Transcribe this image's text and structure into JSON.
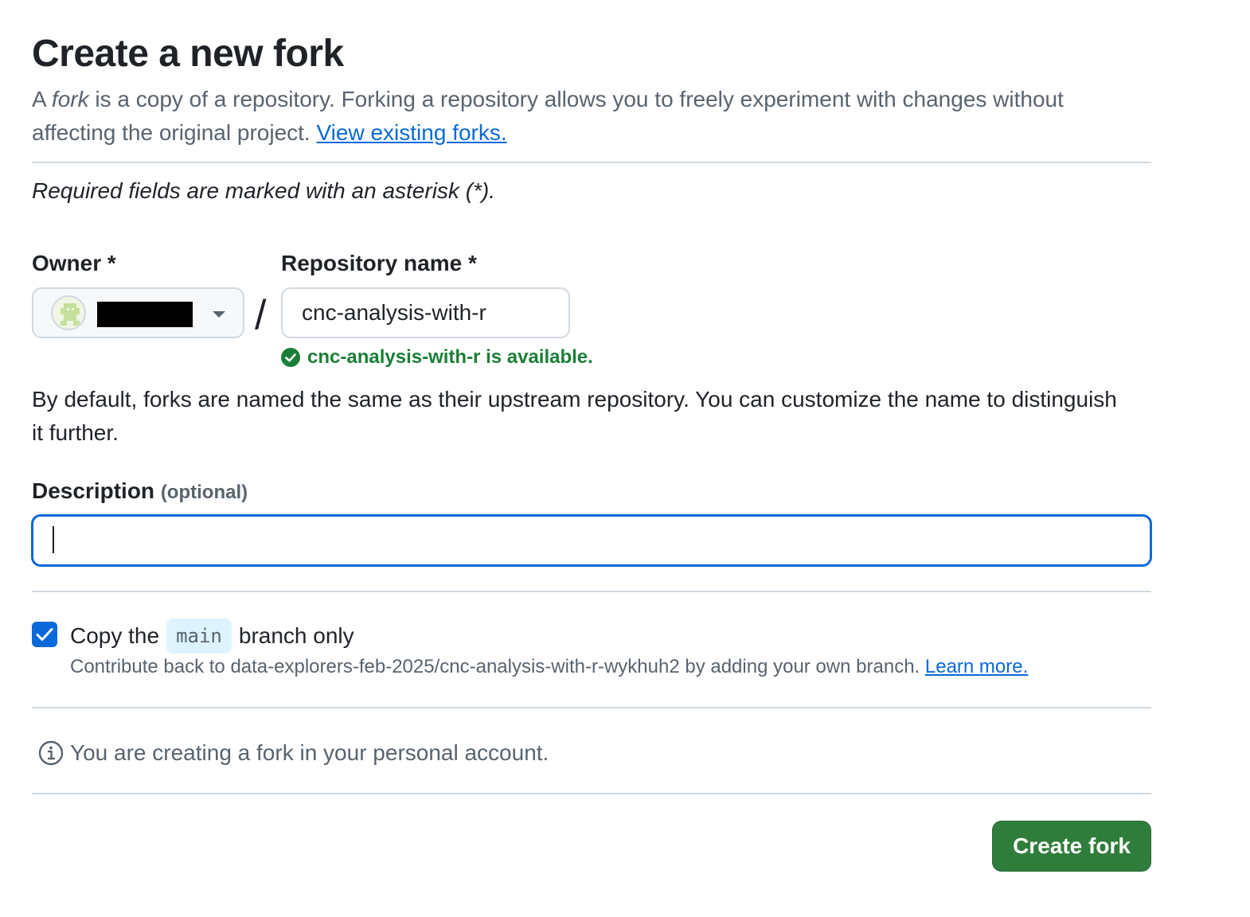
{
  "page": {
    "title": "Create a new fork",
    "intro_a": "A ",
    "intro_em": "fork",
    "intro_b": " is a copy of a repository. Forking a repository allows you to freely experiment with changes without affecting the original project. ",
    "view_forks_link": "View existing forks.",
    "required_note": "Required fields are marked with an asterisk (*)."
  },
  "form": {
    "owner_label": "Owner *",
    "repo_label": "Repository name *",
    "slash": "/",
    "repo_value": "cnc-analysis-with-r",
    "availability": "cnc-analysis-with-r is available.",
    "help_text": "By default, forks are named the same as their upstream repository. You can customize the name to distinguish it further.",
    "description_label": "Description",
    "description_optional": "(optional)",
    "description_value": "",
    "copy_prefix": "Copy the",
    "copy_branch": "main",
    "copy_suffix": "branch only",
    "copy_checked": true,
    "contribute_text": "Contribute back to data-explorers-feb-2025/cnc-analysis-with-r-wykhuh2 by adding your own branch. ",
    "learn_more": "Learn more.",
    "info_text": "You are creating a fork in your personal account.",
    "submit_label": "Create fork"
  },
  "colors": {
    "accent": "#0969da",
    "success": "#1a7f37",
    "button": "#2f7d3a",
    "muted": "#59636e"
  },
  "icons": {
    "owner_avatar": "avatar-icon",
    "dropdown": "caret-down-icon",
    "available": "check-circle-icon",
    "checkbox": "check-icon",
    "info": "info-icon"
  }
}
